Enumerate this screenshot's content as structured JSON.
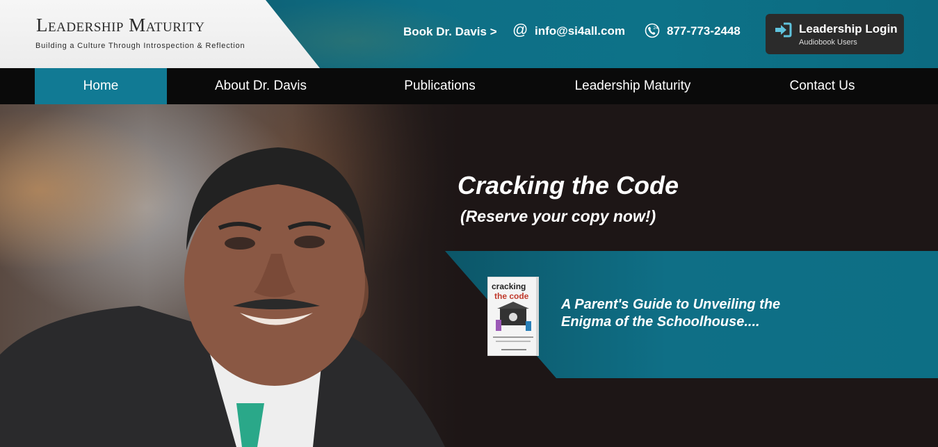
{
  "header": {
    "logo_title": "Leadership Maturity",
    "logo_tagline": "Building a Culture Through Introspection & Reflection",
    "book_link": "Book Dr. Davis >",
    "email_symbol": "@",
    "email": "info@si4all.com",
    "phone": "877-773-2448",
    "login": {
      "label": "Leadership Login",
      "sublabel": "Audiobook Users"
    }
  },
  "nav": {
    "items": [
      {
        "label": "Home",
        "active": true
      },
      {
        "label": "About Dr. Davis",
        "active": false
      },
      {
        "label": "Publications",
        "active": false
      },
      {
        "label": "Leadership Maturity",
        "active": false
      },
      {
        "label": "Contact Us",
        "active": false
      }
    ]
  },
  "hero": {
    "title": "Cracking the Code",
    "subtitle": "(Reserve your copy now!)",
    "band_line1": "A Parent's Guide to Unveiling the",
    "band_line2": "Enigma of the Schoolhouse....",
    "book_cover": {
      "line1": "cracking",
      "line2": "the code"
    }
  },
  "colors": {
    "accent_teal": "#117a94",
    "nav_bg": "#0a0a0a",
    "login_bg": "#2b2b2b",
    "login_icon": "#5fc3dd"
  }
}
